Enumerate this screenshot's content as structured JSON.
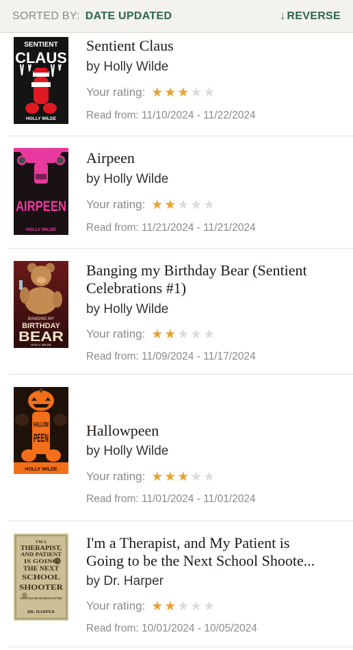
{
  "sortbar": {
    "sorted_by_label": "SORTED BY:",
    "sorted_by_value": "DATE UPDATED",
    "reverse_label": "REVERSE",
    "reverse_icon": "arrow-down-icon"
  },
  "colors": {
    "accent": "#2b6455",
    "star_on": "#e8a233",
    "star_off": "#dcdcdc"
  },
  "books": [
    {
      "title": "Sentient Claus",
      "author": "by Holly Wilde",
      "rating_label": "Your rating:",
      "rating": 3,
      "dates": "Read from: 11/10/2024 - 11/22/2024",
      "cover": {
        "top_text": "SENTIENT",
        "big_text": "CLAUS",
        "author_text": "HOLLY WILDE"
      }
    },
    {
      "title": "Airpeen",
      "author": "by Holly Wilde",
      "rating_label": "Your rating:",
      "rating": 2,
      "dates": "Read from: 11/21/2024 - 11/21/2024",
      "cover": {
        "big_text": "AIRPEEN",
        "author_text": "HOLLY WILDE"
      }
    },
    {
      "title_line1": "Banging my Birthday Bear (Sentient",
      "title_line2": "Celebrations #1)",
      "author": "by Holly Wilde",
      "rating_label": "Your rating:",
      "rating": 2,
      "dates": "Read from: 11/09/2024 - 11/17/2024",
      "cover": {
        "small_text": "BANGING MY",
        "mid_text": "BIRTHDAY",
        "big_text": "BEAR",
        "author_text": "HOLLY WILDE"
      }
    },
    {
      "title": "Hallowpeen",
      "author": "by Holly Wilde",
      "rating_label": "Your rating:",
      "rating": 3,
      "dates": "Read from: 11/01/2024 - 11/01/2024",
      "cover": {
        "line1": "HALLOW",
        "line2": "PEEN",
        "author_text": "HOLLY WILDE"
      }
    },
    {
      "title_line1": "I'm a Therapist, and My Patient is",
      "title_line2": "Going to be the Next School Shoote...",
      "author": "by Dr. Harper",
      "rating_label": "Your rating:",
      "rating": 2,
      "dates": "Read from: 10/01/2024 - 10/05/2024",
      "cover": {
        "l1": "I'M A",
        "l2": "THERAPIST,",
        "l3": "AND PATIENT",
        "l4": "IS GOING",
        "l5": "THE NEXT",
        "l6": "SCHOOL",
        "l7": "SHOOTER",
        "tag": "A PATIENT FILES THAT WILL KEEP YOU UP AT NIGHT",
        "author_text": "DR. HARPER"
      }
    }
  ]
}
